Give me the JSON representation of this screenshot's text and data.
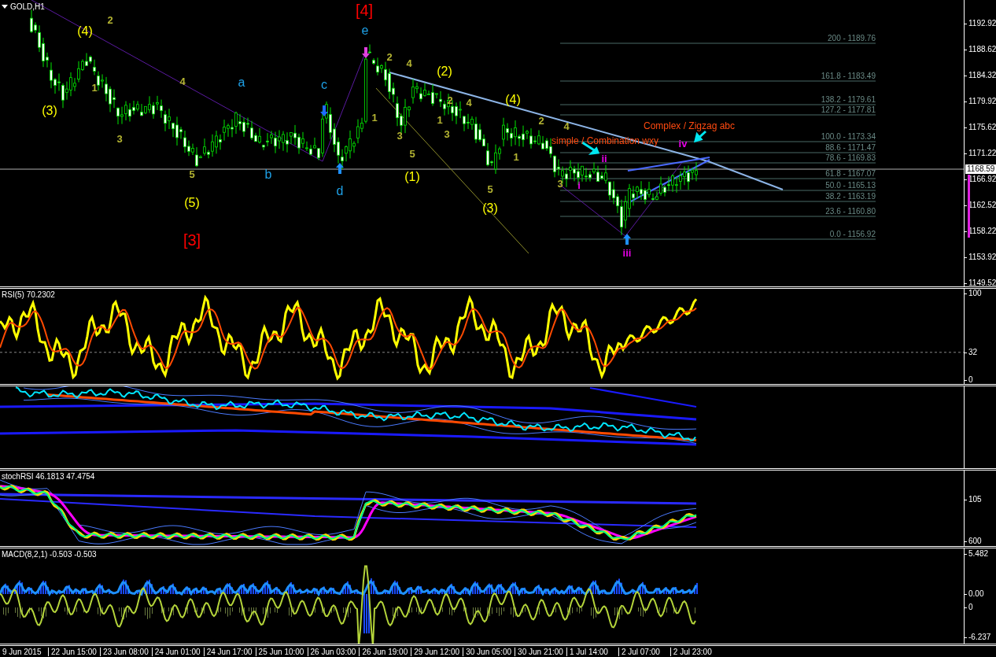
{
  "symbol_label": "GOLD,H1",
  "main_pane": {
    "price_axis": [
      "1192.92",
      "1188.62",
      "1184.32",
      "1179.92",
      "1175.62",
      "1171.22",
      "1166.92",
      "1162.52",
      "1158.22",
      "1153.92",
      "1149.52"
    ],
    "current_price": "1168.59",
    "wave_labels": [
      {
        "text": "(4)",
        "color": "#ffff00"
      },
      {
        "text": "(3)",
        "color": "#ffff00"
      },
      {
        "text": "(5)",
        "color": "#ffff00"
      },
      {
        "text": "(2)",
        "color": "#ffff00"
      },
      {
        "text": "(4)",
        "color": "#ffff00"
      },
      {
        "text": "(1)",
        "color": "#ffff00"
      },
      {
        "text": "(3)",
        "color": "#ffff00"
      },
      {
        "text": "[4]",
        "color": "#ff0000"
      },
      {
        "text": "[3]",
        "color": "#ff0000"
      },
      {
        "text": "a",
        "color": "#1ea0e6"
      },
      {
        "text": "b",
        "color": "#1ea0e6"
      },
      {
        "text": "c",
        "color": "#1ea0e6"
      },
      {
        "text": "d",
        "color": "#1ea0e6"
      },
      {
        "text": "e",
        "color": "#1ea0e6"
      },
      {
        "text": "2",
        "color": "#b4b432"
      },
      {
        "text": "1",
        "color": "#b4b432"
      },
      {
        "text": "4",
        "color": "#b4b432"
      },
      {
        "text": "3",
        "color": "#b4b432"
      },
      {
        "text": "5",
        "color": "#b4b432"
      },
      {
        "text": "2",
        "color": "#b4b432"
      },
      {
        "text": "4",
        "color": "#b4b432"
      },
      {
        "text": "1",
        "color": "#b4b432"
      },
      {
        "text": "3",
        "color": "#b4b432"
      },
      {
        "text": "5",
        "color": "#b4b432"
      },
      {
        "text": "2",
        "color": "#b4b432"
      },
      {
        "text": "4",
        "color": "#b4b432"
      },
      {
        "text": "1",
        "color": "#b4b432"
      },
      {
        "text": "3",
        "color": "#b4b432"
      },
      {
        "text": "5",
        "color": "#b4b432"
      },
      {
        "text": "2",
        "color": "#b4b432"
      },
      {
        "text": "4",
        "color": "#b4b432"
      },
      {
        "text": "1",
        "color": "#b4b432"
      },
      {
        "text": "3",
        "color": "#b4b432"
      },
      {
        "text": "ii",
        "color": "#e600e6"
      },
      {
        "text": "i",
        "color": "#e600e6"
      },
      {
        "text": "iii",
        "color": "#e600e6"
      },
      {
        "text": "iv",
        "color": "#e600e6"
      }
    ],
    "notes": [
      "Complex / Zigzag abc",
      "simple / Combination wxy"
    ],
    "fib_levels": [
      "200 - 1189.76",
      "161.8 - 1183.49",
      "138.2 - 1179.61",
      "127.2 - 1177.81",
      "100.0 - 1173.34",
      "88.6 - 1171.47",
      "78.6 - 1169.83",
      "61.8 - 1167.07",
      "50.0 - 1165.13",
      "38.2 - 1163.19",
      "23.6  - 1160.80",
      "0.0 - 1156.92"
    ]
  },
  "rsi_pane": {
    "title": "RSI(5) 70.2302",
    "axis": [
      "100",
      "32",
      "0"
    ]
  },
  "stoch_pane": {
    "title": "stochRSI 46.1813 47.4754",
    "axis": [
      "105",
      "600"
    ]
  },
  "macd_pane": {
    "title": "MACD(8,2,1) -0.503 -0.503",
    "axis": [
      "5.482",
      "0.00",
      "0",
      "-6.237"
    ]
  },
  "time_axis": [
    "9 Jun 2015",
    "22 Jun 15:00",
    "23 Jun 08:00",
    "24 Jun 01:00",
    "24 Jun 17:00",
    "25 Jun 10:00",
    "26 Jun 03:00",
    "26 Jun 19:00",
    "29 Jun 12:00",
    "30 Jun 05:00",
    "30 Jun 21:00",
    "1 Jul 14:00",
    "2 Jul 07:00",
    "2 Jul 23:00"
  ]
}
